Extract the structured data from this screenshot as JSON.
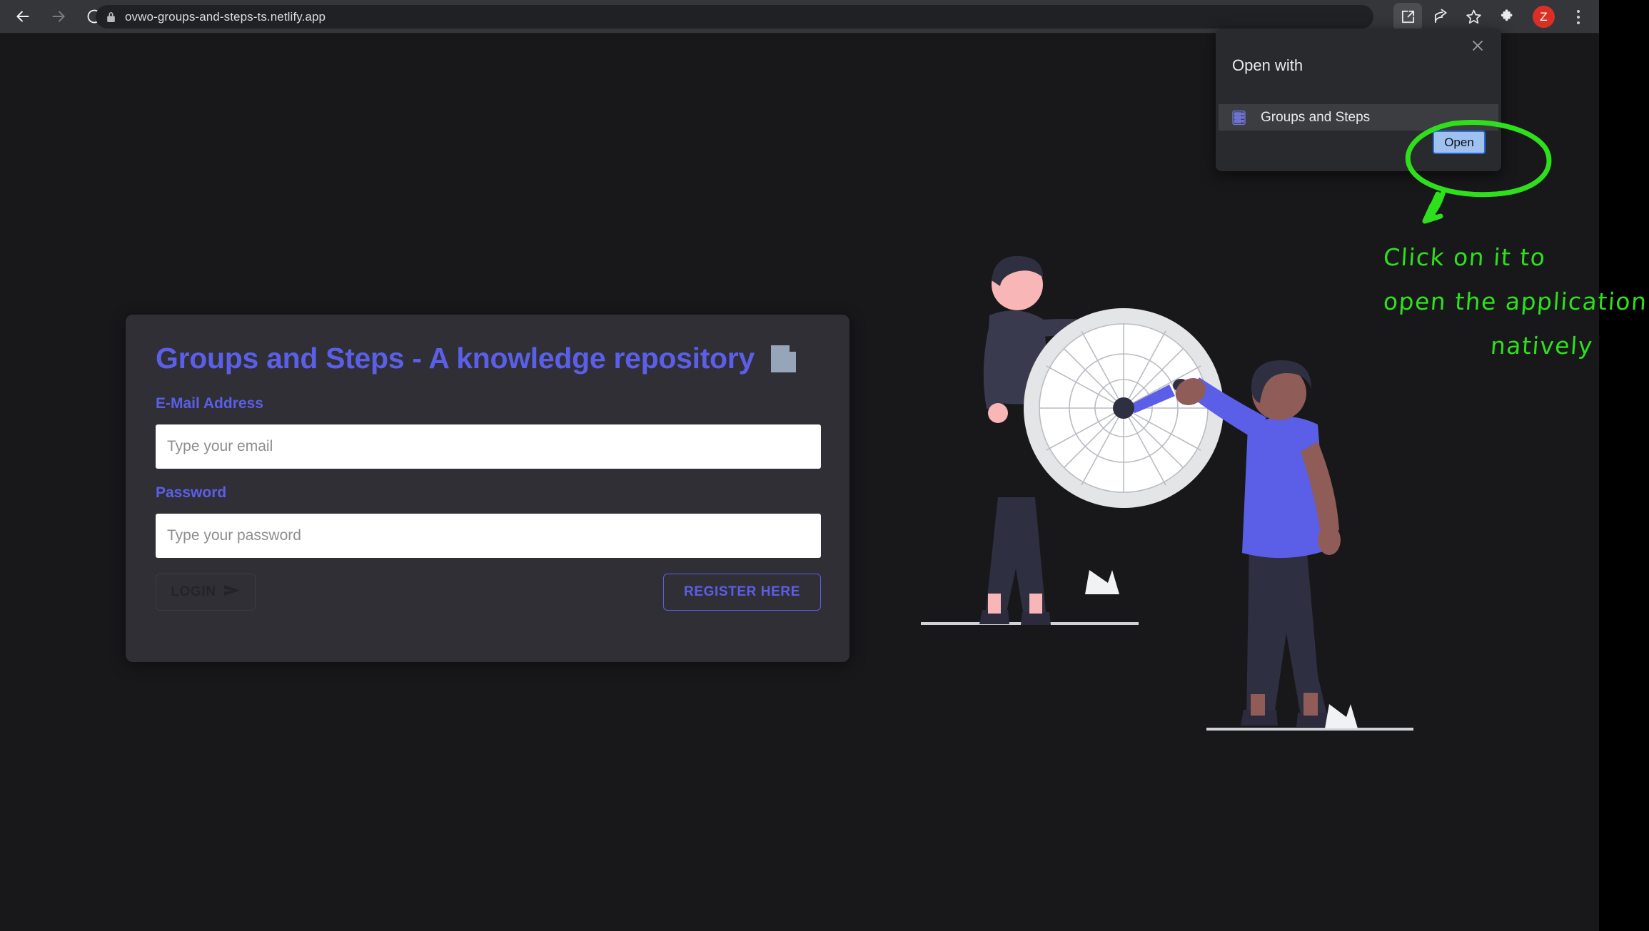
{
  "browser": {
    "url": "ovwo-groups-and-steps-ts.netlify.app",
    "back_label": "Back",
    "forward_label": "Forward",
    "reload_label": "Reload",
    "lock_icon": "lock-icon",
    "toolbar_icons": [
      {
        "name": "open-in-app-icon",
        "label": "Open in app"
      },
      {
        "name": "share-icon",
        "label": "Share this page"
      },
      {
        "name": "bookmark-star-icon",
        "label": "Bookmark this tab"
      },
      {
        "name": "extensions-puzzle-icon",
        "label": "Extensions"
      }
    ],
    "profile_initial": "Z",
    "menu_label": "Customize and control Google Chrome"
  },
  "dialog": {
    "title": "Open with",
    "close_label": "×",
    "app_item": {
      "name": "Groups and Steps",
      "icon": "app-list-icon"
    },
    "open_button": "Open"
  },
  "login": {
    "title": "Groups and Steps - A knowledge repository",
    "title_icon": "notebook-icon",
    "email": {
      "label": "E-Mail Address",
      "placeholder": "Type your email",
      "value": ""
    },
    "password": {
      "label": "Password",
      "placeholder": "Type your password",
      "value": ""
    },
    "login_button": "LOGIN",
    "login_button_icon": "send-arrow-icon",
    "register_button": "REGISTER HERE"
  },
  "illustration": {
    "name": "dartboard-target-illustration",
    "alt": "Two people with a large dartboard, one throwing a dart"
  },
  "annotation": {
    "line1": "Click on it to",
    "line2": "open the application",
    "line3": "natively",
    "color": "#2ee01b",
    "circle_target": "open-button",
    "arrow": "down-left-arrow"
  },
  "colors": {
    "accent": "#5b5fe8",
    "page_background": "#18181b",
    "card_background": "#2f2f35",
    "toolbar_background": "#35363a",
    "dialog_background": "#292a2d",
    "annotation_green": "#2ee01b",
    "avatar_red": "#d93025",
    "open_button_blue": "#9ec1f0"
  }
}
